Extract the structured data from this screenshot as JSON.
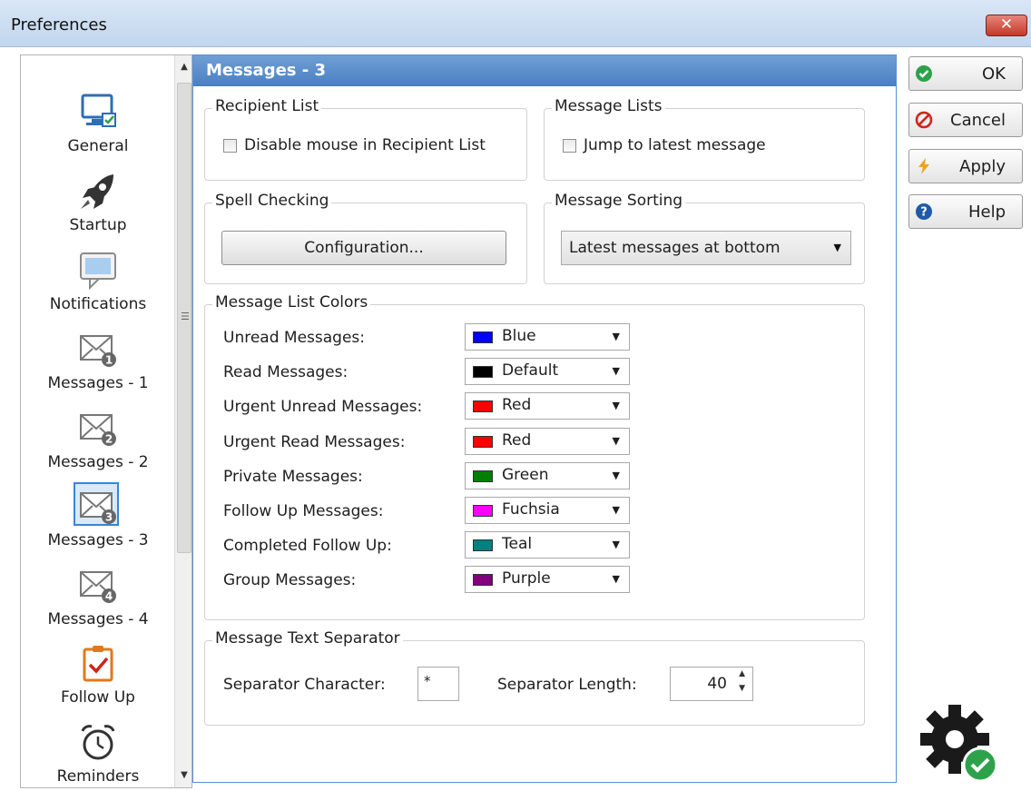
{
  "window": {
    "title": "Preferences",
    "close_glyph": "✕"
  },
  "sidebar": {
    "items": [
      {
        "label": "General",
        "icon": "monitor-icon"
      },
      {
        "label": "Startup",
        "icon": "rocket-icon"
      },
      {
        "label": "Notifications",
        "icon": "speech-bubble-icon"
      },
      {
        "label": "Messages - 1",
        "icon": "envelope-1-icon",
        "badge": "1"
      },
      {
        "label": "Messages - 2",
        "icon": "envelope-2-icon",
        "badge": "2"
      },
      {
        "label": "Messages - 3",
        "icon": "envelope-3-icon",
        "badge": "3",
        "selected": true
      },
      {
        "label": "Messages - 4",
        "icon": "envelope-4-icon",
        "badge": "4"
      },
      {
        "label": "Follow Up",
        "icon": "clipboard-check-icon"
      },
      {
        "label": "Reminders",
        "icon": "alarm-clock-icon"
      }
    ]
  },
  "panel": {
    "title": "Messages - 3",
    "recipient_list": {
      "legend": "Recipient List",
      "checkbox_label": "Disable mouse in Recipient List",
      "checked": false
    },
    "message_lists": {
      "legend": "Message Lists",
      "checkbox_label": "Jump to latest message",
      "checked": false
    },
    "spell_checking": {
      "legend": "Spell Checking",
      "button_label": "Configuration..."
    },
    "message_sorting": {
      "legend": "Message Sorting",
      "selected": "Latest messages at bottom"
    },
    "colors": {
      "legend": "Message List Colors",
      "rows": [
        {
          "label": "Unread Messages:",
          "value": "Blue",
          "swatch": "#0000ff"
        },
        {
          "label": "Read Messages:",
          "value": "Default",
          "swatch": "#000000"
        },
        {
          "label": "Urgent Unread Messages:",
          "value": "Red",
          "swatch": "#ff0000"
        },
        {
          "label": "Urgent Read Messages:",
          "value": "Red",
          "swatch": "#ff0000"
        },
        {
          "label": "Private Messages:",
          "value": "Green",
          "swatch": "#008000"
        },
        {
          "label": "Follow Up Messages:",
          "value": "Fuchsia",
          "swatch": "#ff00ff"
        },
        {
          "label": "Completed Follow Up:",
          "value": "Teal",
          "swatch": "#008080"
        },
        {
          "label": "Group Messages:",
          "value": "Purple",
          "swatch": "#800080"
        }
      ]
    },
    "separator": {
      "legend": "Message Text Separator",
      "char_label": "Separator Character:",
      "char_value": "*",
      "length_label": "Separator Length:",
      "length_value": "40"
    }
  },
  "buttons": {
    "ok": "OK",
    "cancel": "Cancel",
    "apply": "Apply",
    "help": "Help"
  },
  "colors": {
    "header": "#5a8cca",
    "ok_icon": "#2ea24a",
    "cancel_icon": "#d0241b",
    "apply_icon": "#f0a21a",
    "help_icon": "#1f5aa8"
  }
}
